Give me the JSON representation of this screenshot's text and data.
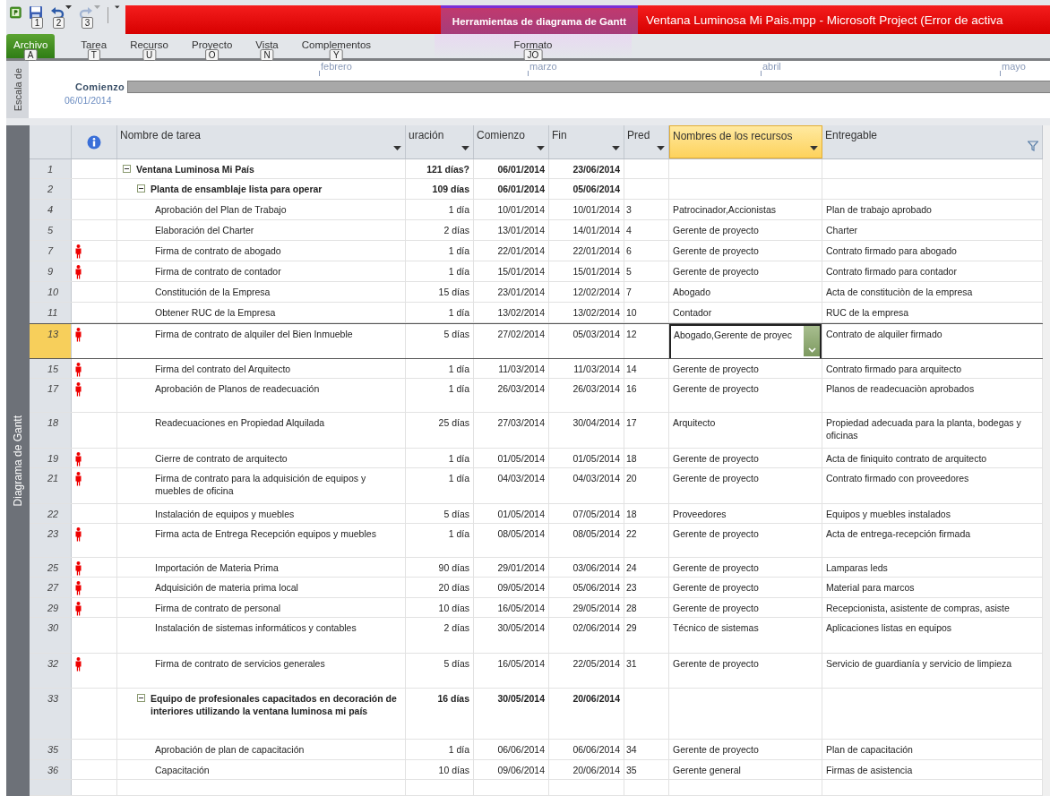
{
  "quick_access": {
    "buttons": [
      {
        "kind": "save",
        "keytip": "1",
        "disabled": false
      },
      {
        "kind": "undo",
        "keytip": "2",
        "disabled": false
      },
      {
        "kind": "redo",
        "keytip": "3",
        "disabled": true
      }
    ]
  },
  "title_bar": {
    "context_title": "Herramientas de diagrama de Gantt",
    "title": "Ventana Luminosa Mi Pais.mpp  -  Microsoft Project (Error de activa"
  },
  "ribbon": {
    "tabs": [
      {
        "label": "Archivo",
        "keytip": "A",
        "kind": "file"
      },
      {
        "label": "Tarea",
        "keytip": "T",
        "kind": "tab"
      },
      {
        "label": "Recurso",
        "keytip": "U",
        "kind": "tab"
      },
      {
        "label": "Proyecto",
        "keytip": "O",
        "kind": "tab"
      },
      {
        "label": "Vista",
        "keytip": "N",
        "kind": "tab"
      },
      {
        "label": "Complementos",
        "keytip": "Y",
        "kind": "tab"
      },
      {
        "label": "Formato",
        "keytip": "JO",
        "kind": "context"
      }
    ]
  },
  "timeline": {
    "side_label": "Escala de",
    "months": [
      "febrero",
      "marzo",
      "abril",
      "mayo"
    ],
    "start_label": "Comienzo",
    "start_date": "06/01/2014"
  },
  "view_bar": {
    "label": "Diagrama de Gantt"
  },
  "grid": {
    "columns": [
      {
        "kind": "id",
        "selected": false
      },
      {
        "kind": "info",
        "selected": false
      },
      {
        "label": "Nombre de tarea",
        "kind": "dropdown",
        "selected": false
      },
      {
        "label": "uración",
        "kind": "dropdown",
        "selected": false
      },
      {
        "label": "Comienzo",
        "kind": "dropdown",
        "selected": false
      },
      {
        "label": "Fin",
        "kind": "dropdown",
        "selected": false
      },
      {
        "label": "Pred",
        "kind": "dropdown",
        "selected": false
      },
      {
        "label": "Nombres de los recursos",
        "kind": "dropdown",
        "selected": true
      },
      {
        "label": "Entregable",
        "kind": "filter",
        "selected": false
      }
    ],
    "tasks": [
      {
        "id": "1",
        "name": "Ventana Luminosa Mi País",
        "duration": "121 días?",
        "start": "06/01/2014",
        "finish": "23/06/2014",
        "selected": false,
        "expanded": true,
        "children": [
          {
            "id": "2",
            "name": "Planta de ensamblaje lista para operar",
            "duration": "109 días",
            "start": "06/01/2014",
            "finish": "05/06/2014",
            "selected": false,
            "expanded": true,
            "children": [
              {
                "id": "4",
                "name": "Aprobación del Plan de Trabajo",
                "duration": "1 día",
                "start": "10/01/2014",
                "finish": "10/01/2014",
                "predecessors": "3",
                "resources": "Patrocinador,Accionistas",
                "deliverable": "Plan de trabajo aprobado",
                "selected": false
              },
              {
                "id": "5",
                "name": "Elaboración del Charter",
                "duration": "2 días",
                "start": "13/01/2014",
                "finish": "14/01/2014",
                "predecessors": "4",
                "resources": "Gerente de proyecto",
                "deliverable": "Charter",
                "selected": false
              },
              {
                "id": "7",
                "resource_indicator": true,
                "name": "Firma de contrato de abogado",
                "duration": "1 día",
                "start": "22/01/2014",
                "finish": "22/01/2014",
                "predecessors": "6",
                "resources": "Gerente de proyecto",
                "deliverable": "Contrato firmado para abogado",
                "selected": false
              },
              {
                "id": "9",
                "resource_indicator": true,
                "name": "Firma de contrato de contador",
                "duration": "1 día",
                "start": "15/01/2014",
                "finish": "15/01/2014",
                "predecessors": "5",
                "resources": "Gerente de proyecto",
                "deliverable": "Contrato firmado para contador",
                "selected": false
              },
              {
                "id": "10",
                "name": "Constitución de la Empresa",
                "duration": "15 días",
                "start": "23/01/2014",
                "finish": "12/02/2014",
                "predecessors": "7",
                "resources": "Abogado",
                "deliverable": "Acta de constituciòn de la empresa",
                "selected": false
              },
              {
                "id": "11",
                "name": "Obtener RUC de la Empresa",
                "duration": "1 día",
                "start": "13/02/2014",
                "finish": "13/02/2014",
                "predecessors": "10",
                "resources": "Contador",
                "deliverable": "RUC de la empresa",
                "selected": false
              },
              {
                "id": "13",
                "resource_indicator": true,
                "name": "Firma de contrato de alquiler del Bien Inmueble",
                "duration": "5 días",
                "start": "27/02/2014",
                "finish": "05/03/2014",
                "predecessors": "12",
                "resources": "Abogado,Gerente de proyec",
                "deliverable": "Contrato de alquiler firmado",
                "selected": true
              },
              {
                "id": "15",
                "resource_indicator": true,
                "name": "Firma del contrato del Arquitecto",
                "duration": "1 día",
                "start": "11/03/2014",
                "finish": "11/03/2014",
                "predecessors": "14",
                "resources": "Gerente de proyecto",
                "deliverable": "Contrato firmado para arquitecto",
                "selected": false
              },
              {
                "id": "17",
                "resource_indicator": true,
                "name": "Aprobación de Planos de readecuación",
                "duration": "1 día",
                "start": "26/03/2014",
                "finish": "26/03/2014",
                "predecessors": "16",
                "resources": "Gerente de proyecto",
                "deliverable": "Planos de readecuaciòn aprobados",
                "selected": false
              },
              {
                "id": "18",
                "name": "Readecuaciones en Propiedad Alquilada",
                "duration": "25 días",
                "start": "27/03/2014",
                "finish": "30/04/2014",
                "predecessors": "17",
                "resources": "Arquitecto",
                "deliverable": "Propiedad adecuada para la planta, bodegas y oficinas",
                "selected": false
              },
              {
                "id": "19",
                "resource_indicator": true,
                "name": "Cierre de contrato de arquitecto",
                "duration": "1 día",
                "start": "01/05/2014",
                "finish": "01/05/2014",
                "predecessors": "18",
                "resources": "Gerente de proyecto",
                "deliverable": "Acta de finiquito contrato de arquitecto",
                "selected": false
              },
              {
                "id": "21",
                "resource_indicator": true,
                "name": "Firma de contrato para la adquisición de equipos y muebles de oficina",
                "duration": "1 día",
                "start": "04/03/2014",
                "finish": "04/03/2014",
                "predecessors": "20",
                "resources": "Gerente de proyecto",
                "deliverable": "Contrato firmado con proveedores",
                "selected": false
              },
              {
                "id": "22",
                "name": "Instalación de equipos y muebles",
                "duration": "5 días",
                "start": "01/05/2014",
                "finish": "07/05/2014",
                "predecessors": "18",
                "resources": "Proveedores",
                "deliverable": "Equipos y muebles instalados",
                "selected": false
              },
              {
                "id": "23",
                "resource_indicator": true,
                "name": "Firma acta de Entrega Recepción equipos y muebles",
                "duration": "1 día",
                "start": "08/05/2014",
                "finish": "08/05/2014",
                "predecessors": "22",
                "resources": "Gerente de proyecto",
                "deliverable": "Acta de entrega-recepción firmada",
                "selected": false
              },
              {
                "id": "25",
                "resource_indicator": true,
                "name": "Importación de Materia Prima",
                "duration": "90 días",
                "start": "29/01/2014",
                "finish": "03/06/2014",
                "predecessors": "24",
                "resources": "Gerente de proyecto",
                "deliverable": "Lamparas leds",
                "selected": false
              },
              {
                "id": "27",
                "resource_indicator": true,
                "name": "Adquisición de materia prima local",
                "duration": "20 días",
                "start": "09/05/2014",
                "finish": "05/06/2014",
                "predecessors": "23",
                "resources": "Gerente de proyecto",
                "deliverable": "Material para marcos",
                "selected": false
              },
              {
                "id": "29",
                "resource_indicator": true,
                "name": "Firma de contrato de personal",
                "duration": "10 días",
                "start": "16/05/2014",
                "finish": "29/05/2014",
                "predecessors": "28",
                "resources": "Gerente de proyecto",
                "deliverable": "Recepcionista, asistente de compras, asiste",
                "selected": false
              },
              {
                "id": "30",
                "name": "Instalación de sistemas informáticos y contables",
                "duration": "2 días",
                "start": "30/05/2014",
                "finish": "02/06/2014",
                "predecessors": "29",
                "resources": "Técnico de sistemas",
                "deliverable": "Aplicaciones listas en equipos",
                "selected": false
              },
              {
                "id": "32",
                "resource_indicator": true,
                "name": "Firma de contrato de servicios generales",
                "duration": "5 días",
                "start": "16/05/2014",
                "finish": "22/05/2014",
                "predecessors": "31",
                "resources": "Gerente de proyecto",
                "deliverable": "Servicio de guardianía y servicio de limpieza",
                "selected": false
              }
            ]
          },
          {
            "id": "33",
            "name": "Equipo de profesionales capacitados en decoración de interiores utilizando la ventana luminosa mi país",
            "duration": "16 días",
            "start": "30/05/2014",
            "finish": "20/06/2014",
            "selected": false,
            "expanded": true,
            "children": [
              {
                "id": "35",
                "name": "Aprobación de plan de capacitación",
                "duration": "1 día",
                "start": "06/06/2014",
                "finish": "06/06/2014",
                "predecessors": "34",
                "resources": "Gerente de proyecto",
                "deliverable": "Plan de capacitación",
                "selected": false
              },
              {
                "id": "36",
                "name": "Capacitación",
                "duration": "10 días",
                "start": "09/06/2014",
                "finish": "20/06/2014",
                "predecessors": "35",
                "resources": "Gerente general",
                "deliverable": "Firmas de asistencia",
                "selected": false
              }
            ]
          }
        ]
      }
    ]
  }
}
